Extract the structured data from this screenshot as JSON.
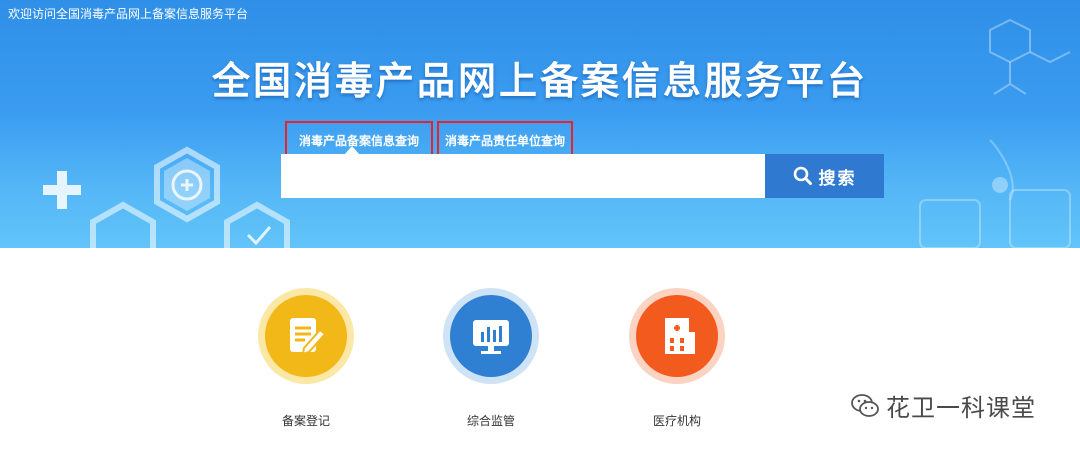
{
  "header": {
    "welcome": "欢迎访问全国消毒产品网上备案信息服务平台",
    "title": "全国消毒产品网上备案信息服务平台"
  },
  "search": {
    "tabs": [
      {
        "label": "消毒产品备案信息查询",
        "active": true
      },
      {
        "label": "消毒产品责任单位查询",
        "active": false
      }
    ],
    "input_value": "",
    "button_label": "搜索",
    "button_icon": "search-icon",
    "highlight_color": "#e8232a"
  },
  "features": [
    {
      "label": "备案登记",
      "icon": "notebook-pen-icon",
      "color": "#f2b817"
    },
    {
      "label": "综合监管",
      "icon": "monitor-chart-icon",
      "color": "#2f7fd2"
    },
    {
      "label": "医疗机构",
      "icon": "hospital-icon",
      "color": "#f25a1e"
    }
  ],
  "watermark": {
    "text": "花卫一科课堂",
    "icon": "wechat-icon"
  }
}
